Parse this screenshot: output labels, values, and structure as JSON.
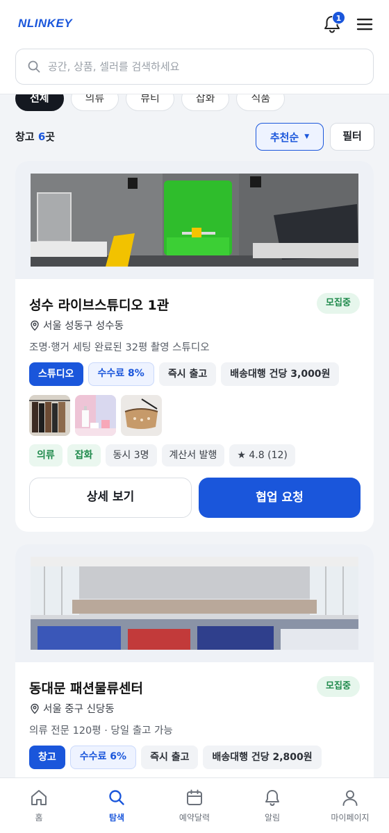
{
  "header": {
    "logo": "NLINKEY",
    "notification_count": "1",
    "search_placeholder": "공간, 상품, 셀러를 검색하세요"
  },
  "categories": [
    {
      "label": "전체",
      "active": true
    },
    {
      "label": "의류",
      "active": false
    },
    {
      "label": "뷰티",
      "active": false
    },
    {
      "label": "잡화",
      "active": false
    },
    {
      "label": "식품",
      "active": false
    }
  ],
  "results": {
    "prefix": "창고 ",
    "count": "6",
    "suffix": "곳",
    "sort_label": "추천순",
    "filter_label": "필터"
  },
  "cards": [
    {
      "title": "성수 라이브스튜디오 1관",
      "status": "모집중",
      "location": "서울 성동구 성수동",
      "description": "조명·행거 세팅 완료된 32평 촬영 스튜디오",
      "tags": [
        "스튜디오",
        "수수료 8%",
        "즉시 출고",
        "배송대행 건당 3,000원"
      ],
      "meta": [
        "의류",
        "잡화",
        "동시 3명",
        "계산서 발행",
        "★ 4.8 (12)"
      ],
      "detail_label": "상세 보기",
      "collab_label": "협업 요청"
    },
    {
      "title": "동대문 패션물류센터",
      "status": "모집중",
      "location": "서울 중구 신당동",
      "description": "의류 전문 120평 · 당일 출고 가능",
      "tags": [
        "창고",
        "수수료 6%",
        "즉시 출고",
        "배송대행 건당 2,800원"
      ]
    }
  ],
  "bottom_nav": [
    {
      "label": "홈",
      "icon": "home-icon",
      "active": false
    },
    {
      "label": "탐색",
      "icon": "search-icon",
      "active": true
    },
    {
      "label": "예약달력",
      "icon": "calendar-icon",
      "active": false
    },
    {
      "label": "알림",
      "icon": "bell-icon",
      "active": false
    },
    {
      "label": "마이페이지",
      "icon": "user-icon",
      "active": false
    }
  ],
  "colors": {
    "accent": "#1a56db",
    "status_green": "#1f8a4c",
    "chip_active": "#141820"
  }
}
